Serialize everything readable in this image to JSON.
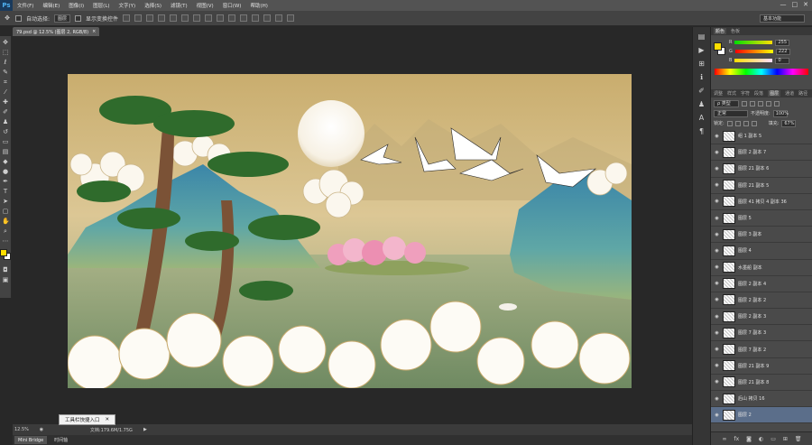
{
  "app": {
    "logo": "Ps"
  },
  "menu": [
    "文件(F)",
    "编辑(E)",
    "图像(I)",
    "图层(L)",
    "文字(Y)",
    "选择(S)",
    "滤镜(T)",
    "视图(V)",
    "窗口(W)",
    "帮助(H)"
  ],
  "window_controls": {
    "minimize": "—",
    "maximize": "□",
    "close": "✕"
  },
  "options": {
    "auto_select_label": "自动选择:",
    "auto_select_value": "图层",
    "show_transform_label": "显示变换控件",
    "workspace": "基本功能"
  },
  "document_tab": {
    "title": "79.psd @ 12.5% (图层 2, RGB/8)",
    "close": "×"
  },
  "status": {
    "zoom": "12.5%",
    "doc_info": "文档:179.6M/1.75G"
  },
  "tooltip": {
    "text": "工具栏快捷入口",
    "close": "✕"
  },
  "bottom_tabs": [
    "Mini Bridge",
    "时间轴"
  ],
  "color_panel": {
    "tabs": [
      "颜色",
      "色板"
    ],
    "r_label": "R",
    "r_value": "255",
    "g_label": "G",
    "g_value": "222",
    "b_label": "B",
    "b_value": "0",
    "foreground": "#ffde00",
    "background": "#ffffff"
  },
  "layers_panel": {
    "tabs": [
      "调整",
      "样式",
      "字符",
      "段落",
      "图层",
      "通道",
      "路径"
    ],
    "filter_kind": "ρ 类型",
    "blend_mode": "正常",
    "opacity_label": "不透明度:",
    "opacity_value": "100%",
    "lock_label": "锁定:",
    "fill_label": "填充:",
    "fill_value": "67%",
    "layers": [
      {
        "name": "组 1 副本 5",
        "selected": false
      },
      {
        "name": "图层 2 副本 7",
        "selected": false
      },
      {
        "name": "图层 21 副本 6",
        "selected": false
      },
      {
        "name": "图层 21 副本 5",
        "selected": false
      },
      {
        "name": "图层 41 拷贝 4 副本 36",
        "selected": false
      },
      {
        "name": "图层 5",
        "selected": false
      },
      {
        "name": "图层 3 副本",
        "selected": false
      },
      {
        "name": "图层 4",
        "selected": false
      },
      {
        "name": "水墨船 副本",
        "selected": false
      },
      {
        "name": "图层 2 副本 4",
        "selected": false
      },
      {
        "name": "图层 2 副本 2",
        "selected": false
      },
      {
        "name": "图层 2 副本 3",
        "selected": false
      },
      {
        "name": "图层 7 副本 3",
        "selected": false
      },
      {
        "name": "图层 7 副本 2",
        "selected": false
      },
      {
        "name": "图层 21 副本 9",
        "selected": false
      },
      {
        "name": "图层 21 副本 8",
        "selected": false
      },
      {
        "name": "后山 拷贝 16",
        "selected": false
      },
      {
        "name": "图层 2",
        "selected": true
      }
    ]
  }
}
